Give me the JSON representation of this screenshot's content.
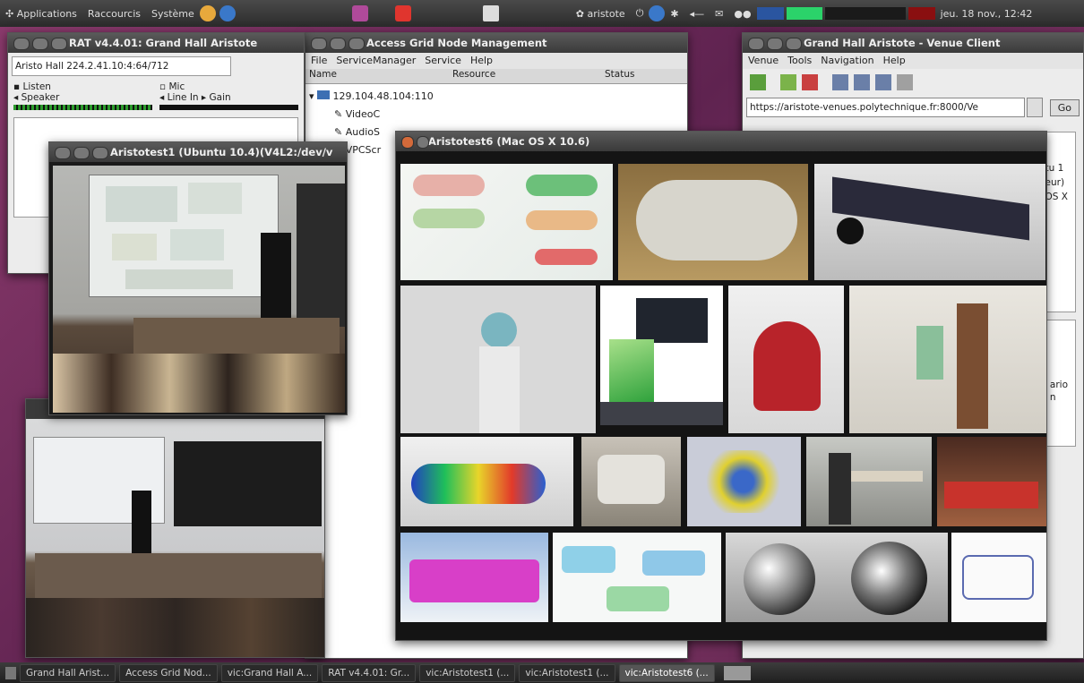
{
  "top_panel": {
    "applications": "Applications",
    "places": "Raccourcis",
    "system": "Système",
    "user": "aristote",
    "clock": "jeu. 18 nov., 12:42"
  },
  "rat": {
    "title": "RAT v4.4.01: Grand Hall Aristote",
    "address": "Aristo Hall  224.2.41.10:4:64/712",
    "listen": "Listen",
    "speaker": "Speaker",
    "mic": "Mic",
    "line_in": "Line In",
    "gain": "Gain"
  },
  "agnm": {
    "title": "Access Grid Node Management",
    "menu": [
      "File",
      "ServiceManager",
      "Service",
      "Help"
    ],
    "columns": [
      "Name",
      "Resource",
      "Status"
    ],
    "node": "129.104.48.104:110",
    "services": [
      "VideoC",
      "AudioS",
      "VPCScr"
    ]
  },
  "venue": {
    "title": "Grand Hall Aristote - Venue Client",
    "menu": [
      "Venue",
      "Tools",
      "Navigation",
      "Help"
    ],
    "url": "https://aristote-venues.polytechnique.fr:8000/Ve",
    "go": "Go",
    "side_texts": [
      "tu 1",
      "eur)",
      "OS X",
      "ario",
      "n"
    ]
  },
  "video1": {
    "title": "Aristotest1 (Ubuntu 10.4)(V4L2:/dev/v"
  },
  "video6": {
    "title": "Aristotest6 (Mac OS X 10.6)"
  },
  "taskbar": [
    "Grand Hall Arist...",
    "Access Grid Nod...",
    "vic:Grand Hall A...",
    "RAT v4.4.01: Gr...",
    "vic:Aristotest1 (...",
    "vic:Aristotest1 (...",
    "vic:Aristotest6 (..."
  ],
  "colors": {
    "desktop": "#6e2b58",
    "panel": "#333333",
    "titlebar": "#4a4a4a"
  }
}
